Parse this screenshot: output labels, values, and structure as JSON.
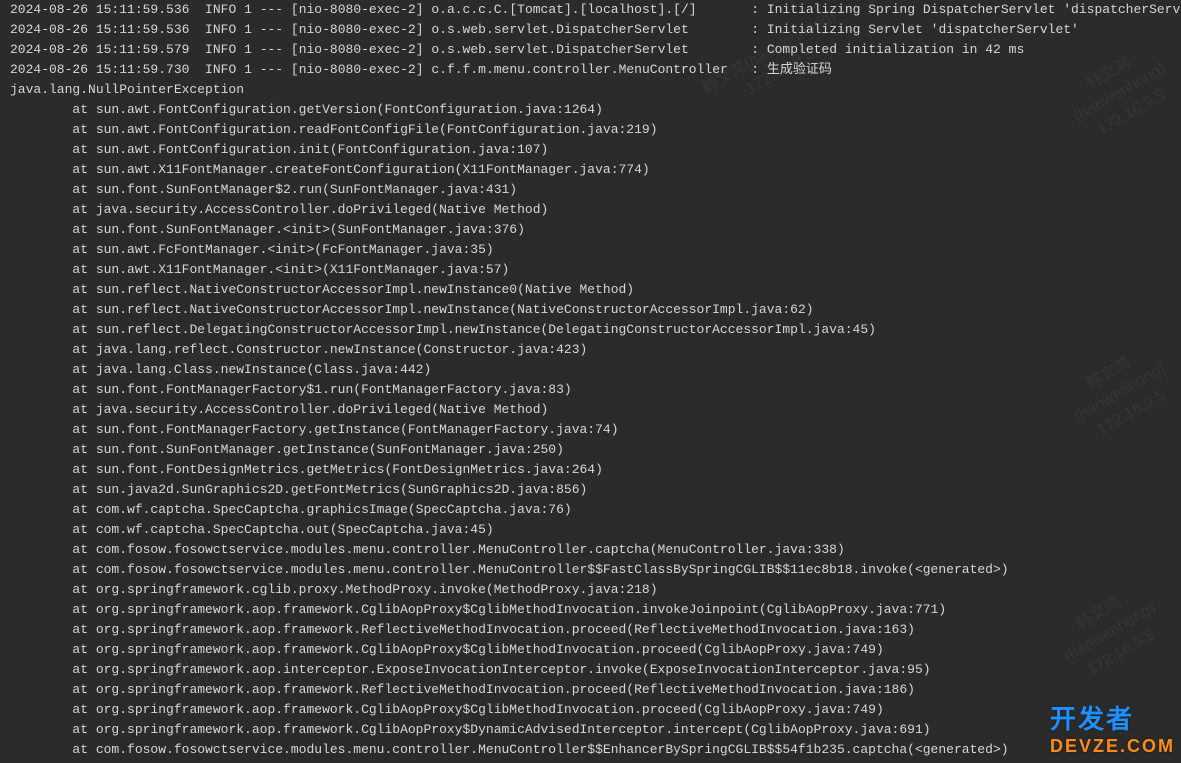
{
  "log_lines": [
    {
      "ts": "2024-08-26 15:11:59.536",
      "lvl": "INFO",
      "pid": "1",
      "thread": "[nio-8080-exec-2]",
      "logger": "o.a.c.c.C.[Tomcat].[localhost].[/]     ",
      "msg": "Initializing Spring DispatcherServlet 'dispatcherServlet'"
    },
    {
      "ts": "2024-08-26 15:11:59.536",
      "lvl": "INFO",
      "pid": "1",
      "thread": "[nio-8080-exec-2]",
      "logger": "o.s.web.servlet.DispatcherServlet      ",
      "msg": "Initializing Servlet 'dispatcherServlet'"
    },
    {
      "ts": "2024-08-26 15:11:59.579",
      "lvl": "INFO",
      "pid": "1",
      "thread": "[nio-8080-exec-2]",
      "logger": "o.s.web.servlet.DispatcherServlet      ",
      "msg": "Completed initialization in 42 ms"
    },
    {
      "ts": "2024-08-26 15:11:59.730",
      "lvl": "INFO",
      "pid": "1",
      "thread": "[nio-8080-exec-2]",
      "logger": "c.f.f.m.menu.controller.MenuController ",
      "msg": "生成验证码"
    }
  ],
  "exception_header": "java.lang.NullPointerException",
  "stack": [
    "at sun.awt.FontConfiguration.getVersion(FontConfiguration.java:1264)",
    "at sun.awt.FontConfiguration.readFontConfigFile(FontConfiguration.java:219)",
    "at sun.awt.FontConfiguration.init(FontConfiguration.java:107)",
    "at sun.awt.X11FontManager.createFontConfiguration(X11FontManager.java:774)",
    "at sun.font.SunFontManager$2.run(SunFontManager.java:431)",
    "at java.security.AccessController.doPrivileged(Native Method)",
    "at sun.font.SunFontManager.<init>(SunFontManager.java:376)",
    "at sun.awt.FcFontManager.<init>(FcFontManager.java:35)",
    "at sun.awt.X11FontManager.<init>(X11FontManager.java:57)",
    "at sun.reflect.NativeConstructorAccessorImpl.newInstance0(Native Method)",
    "at sun.reflect.NativeConstructorAccessorImpl.newInstance(NativeConstructorAccessorImpl.java:62)",
    "at sun.reflect.DelegatingConstructorAccessorImpl.newInstance(DelegatingConstructorAccessorImpl.java:45)",
    "at java.lang.reflect.Constructor.newInstance(Constructor.java:423)",
    "at java.lang.Class.newInstance(Class.java:442)",
    "at sun.font.FontManagerFactory$1.run(FontManagerFactory.java:83)",
    "at java.security.AccessController.doPrivileged(Native Method)",
    "at sun.font.FontManagerFactory.getInstance(FontManagerFactory.java:74)",
    "at sun.font.SunFontManager.getInstance(SunFontManager.java:250)",
    "at sun.font.FontDesignMetrics.getMetrics(FontDesignMetrics.java:264)",
    "at sun.java2d.SunGraphics2D.getFontMetrics(SunGraphics2D.java:856)",
    "at com.wf.captcha.SpecCaptcha.graphicsImage(SpecCaptcha.java:76)",
    "at com.wf.captcha.SpecCaptcha.out(SpecCaptcha.java:45)",
    "at com.fosow.fosowctservice.modules.menu.controller.MenuController.captcha(MenuController.java:338)",
    "at com.fosow.fosowctservice.modules.menu.controller.MenuController$$FastClassBySpringCGLIB$$11ec8b18.invoke(<generated>)",
    "at org.springframework.cglib.proxy.MethodProxy.invoke(MethodProxy.java:218)",
    "at org.springframework.aop.framework.CglibAopProxy$CglibMethodInvocation.invokeJoinpoint(CglibAopProxy.java:771)",
    "at org.springframework.aop.framework.ReflectiveMethodInvocation.proceed(ReflectiveMethodInvocation.java:163)",
    "at org.springframework.aop.framework.CglibAopProxy$CglibMethodInvocation.proceed(CglibAopProxy.java:749)",
    "at org.springframework.aop.interceptor.ExposeInvocationInterceptor.invoke(ExposeInvocationInterceptor.java:95)",
    "at org.springframework.aop.framework.ReflectiveMethodInvocation.proceed(ReflectiveMethodInvocation.java:186)",
    "at org.springframework.aop.framework.CglibAopProxy$CglibMethodInvocation.proceed(CglibAopProxy.java:749)",
    "at org.springframework.aop.framework.CglibAopProxy$DynamicAdvisedInterceptor.intercept(CglibAopProxy.java:691)",
    "at com.fosow.fosowctservice.modules.menu.controller.MenuController$$EnhancerBySpringCGLIB$$54f1b235.captcha(<generated>)"
  ],
  "watermarks": [
    {
      "name": "韩文鸿(hanwenhong)",
      "ip": "172.16.9.5"
    }
  ],
  "brand": {
    "cn": "开发者",
    "en": "DEVZE.COM"
  }
}
